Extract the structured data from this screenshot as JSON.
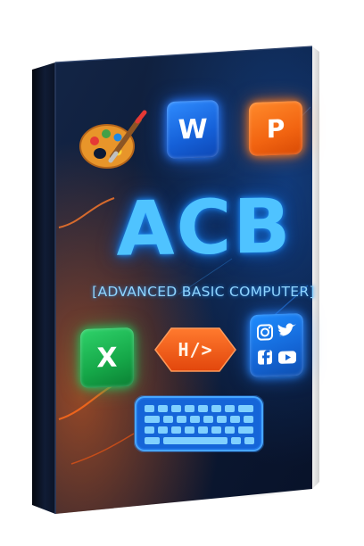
{
  "book": {
    "title": "ACB",
    "subtitle": "[ADVANCED BASIC COMPUTER]",
    "cover_color": "#0c1a33",
    "spine_color": "#08101f"
  },
  "icons": {
    "palette": "palette-brush-icon",
    "word": {
      "icon": "word-icon",
      "letter": "W",
      "color": "#1e6ff0"
    },
    "powerpoint": {
      "icon": "powerpoint-icon",
      "letter": "P",
      "color": "#f26a16"
    },
    "excel": {
      "icon": "excel-icon",
      "letter": "X",
      "color": "#1aa84c"
    },
    "html": {
      "icon": "html-code-icon",
      "label": "H/>",
      "color": "#f15a16"
    },
    "social": {
      "icon": "social-media-icon",
      "items": [
        "instagram-icon",
        "twitter-icon",
        "facebook-icon",
        "youtube-icon"
      ]
    },
    "keyboard": {
      "icon": "keyboard-icon",
      "color": "#1e88ff"
    }
  }
}
